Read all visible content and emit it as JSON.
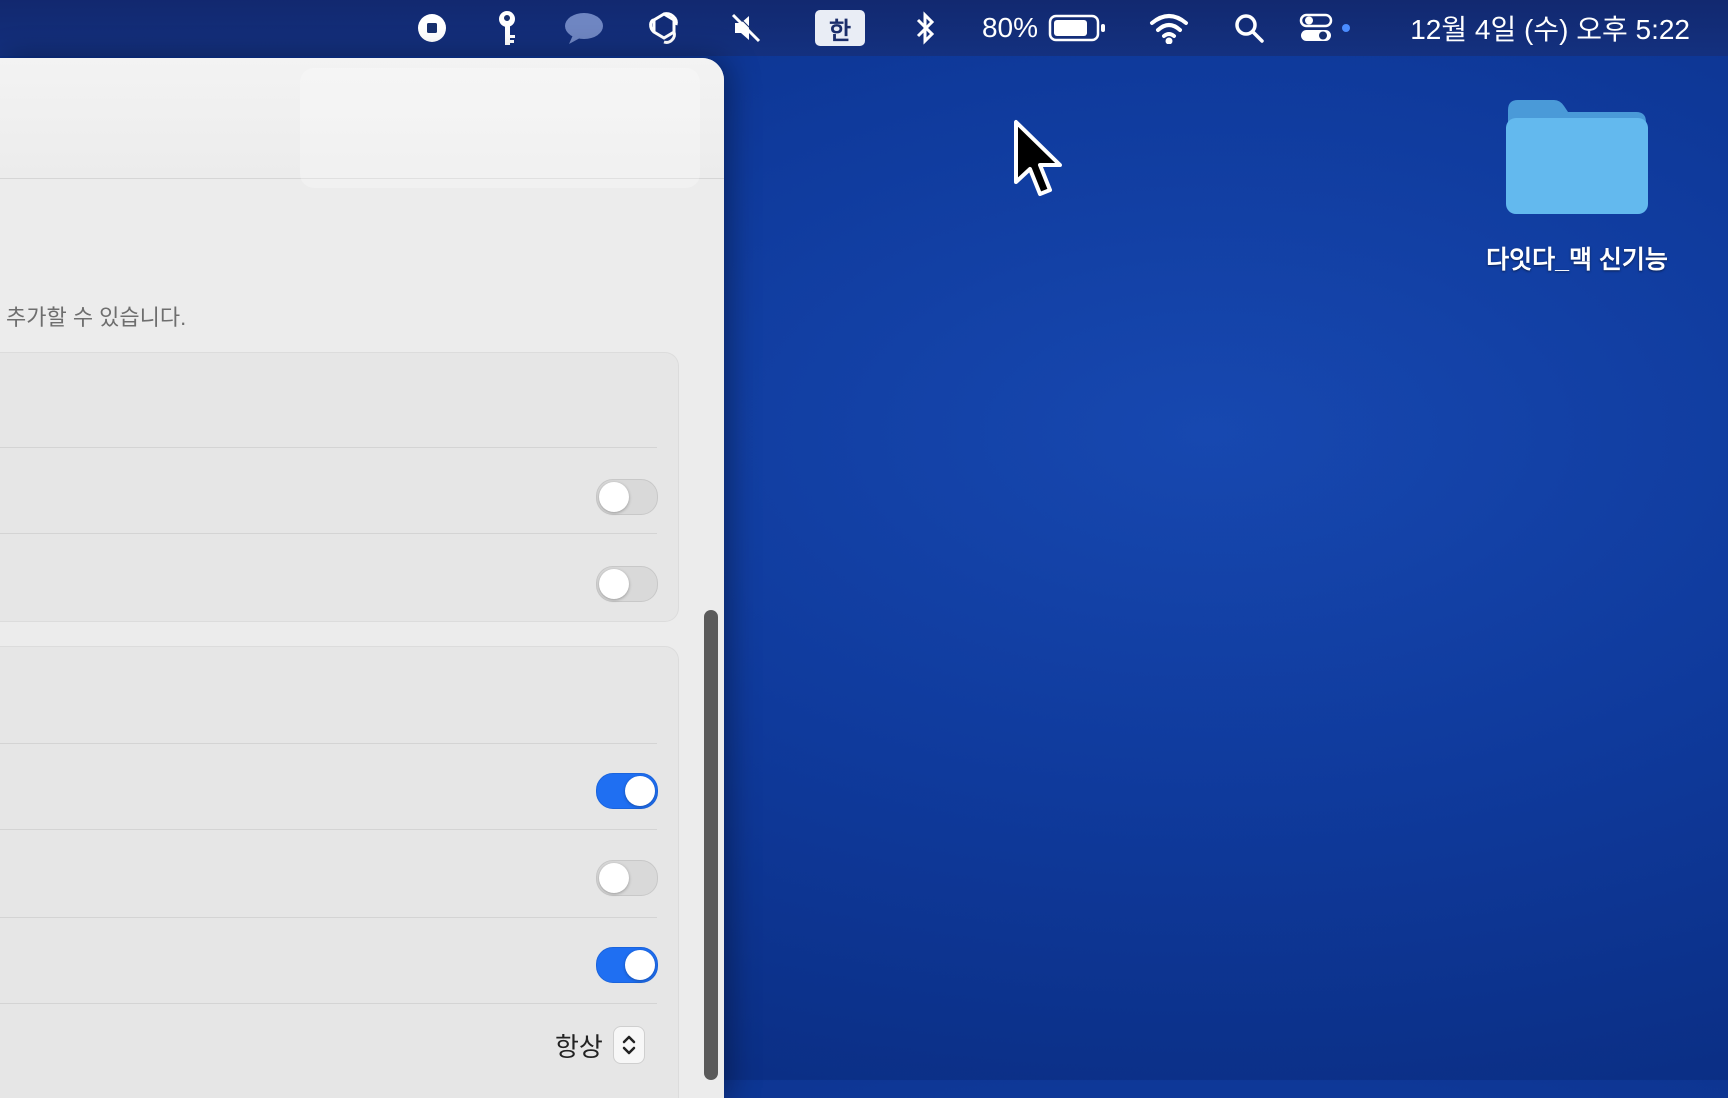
{
  "menubar": {
    "icons": [
      "record-icon",
      "key-icon",
      "chat-bubble-icon",
      "chatgpt-icon",
      "mute-icon",
      "input-source",
      "bluetooth-icon",
      "battery-icon",
      "wifi-icon",
      "search-icon",
      "control-center-icon"
    ],
    "input_source": "한",
    "battery_percent": "80%",
    "datetime": "12월 4일 (수) 오후 5:22"
  },
  "settings": {
    "description": "추가할 수 있습니다.",
    "toggles": [
      false,
      false,
      true,
      false,
      true
    ],
    "popup_value": "항상"
  },
  "desktop": {
    "folder_label": "다잇다_맥 신기능"
  },
  "colors": {
    "accent": "#1f6ff2",
    "desktop": "#0f3a9c",
    "folder": "#63b9ee"
  }
}
